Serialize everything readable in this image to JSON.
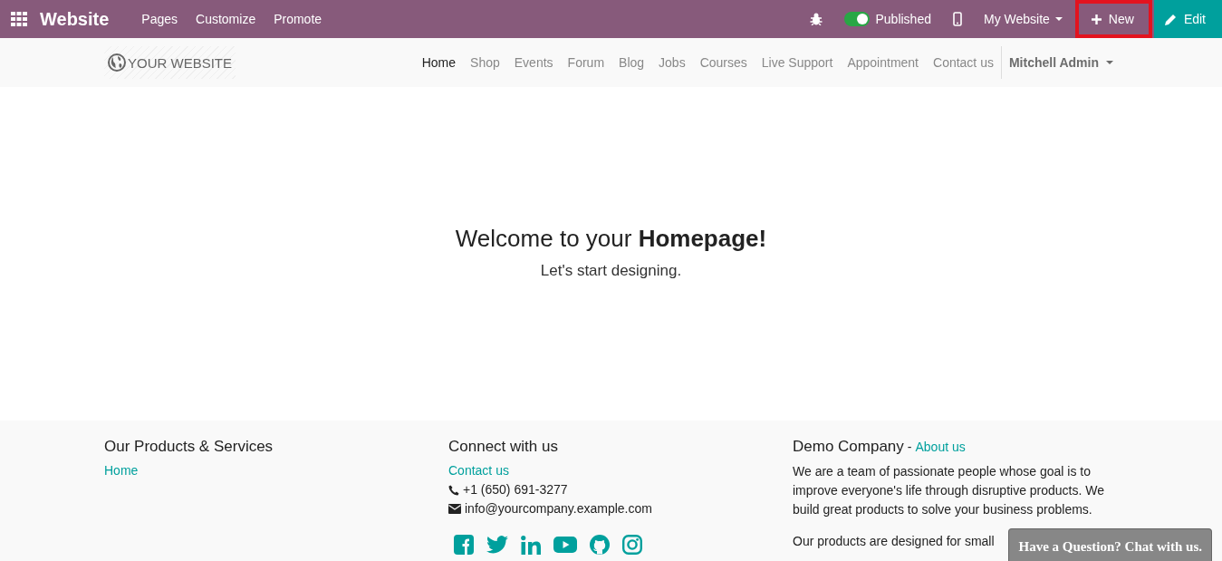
{
  "topbar": {
    "app_title": "Website",
    "menu": [
      "Pages",
      "Customize",
      "Promote"
    ],
    "published": {
      "label": "Published",
      "on": true
    },
    "website_menu": "My Website",
    "new_button": {
      "label": "New",
      "highlighted": true
    },
    "edit_button": "Edit"
  },
  "navbar": {
    "logo": "YOUR WEBSITE",
    "links": [
      {
        "label": "Home",
        "selected": true
      },
      {
        "label": "Shop",
        "selected": false
      },
      {
        "label": "Events",
        "selected": false
      },
      {
        "label": "Forum",
        "selected": false
      },
      {
        "label": "Blog",
        "selected": false
      },
      {
        "label": "Jobs",
        "selected": false
      },
      {
        "label": "Courses",
        "selected": false
      },
      {
        "label": "Live Support",
        "selected": false
      },
      {
        "label": "Appointment",
        "selected": false
      },
      {
        "label": "Contact us",
        "selected": false
      }
    ],
    "user": "Mitchell Admin"
  },
  "hero": {
    "title": "Welcome to your **Homepage!**",
    "subtitle": "Let's start designing."
  },
  "footer": {
    "products": {
      "title": "Our Products & Services",
      "links": [
        "Home"
      ]
    },
    "connect": {
      "title": "Connect with us",
      "link": "Contact us",
      "phone": "+1 (650) 691-3277",
      "email": "info@yourcompany.example.com",
      "social": [
        {
          "kind": "facebook"
        },
        {
          "kind": "twitter"
        },
        {
          "kind": "linkedin"
        },
        {
          "kind": "youtube"
        },
        {
          "kind": "github"
        },
        {
          "kind": "instagram"
        }
      ]
    },
    "company": {
      "name": "Demo Company",
      "separator": "-",
      "link": "About us",
      "paragraphs": [
        "We are a team of passionate people whose goal is to improve everyone's life through disruptive products. We build great products to solve your business problems.",
        "Our products are designed for small"
      ]
    }
  },
  "chat_button": "Have a Question? Chat with us."
}
